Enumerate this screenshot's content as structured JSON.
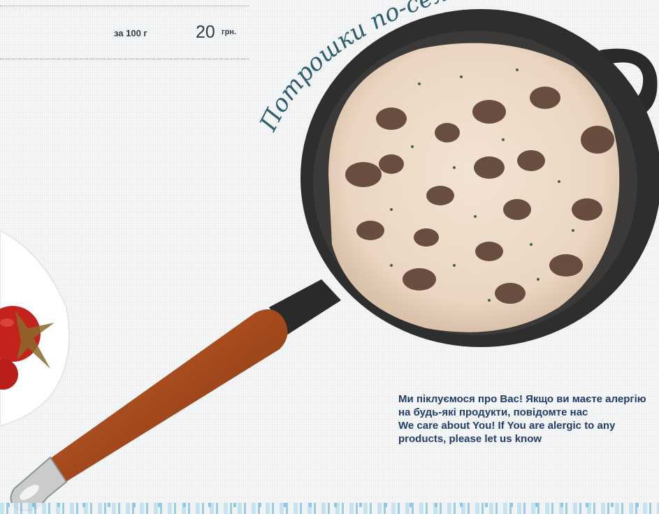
{
  "menu_item": {
    "title": "Потрошки по-селянськи",
    "per_weight": "за 100 г",
    "price": "20",
    "currency": "грн."
  },
  "notice": {
    "line1": "Ми піклуємося  про Вас! Якщо ви маєте алергію",
    "line2": "на будь-які продукти, повідомте нас",
    "line3": "We care about You! If You are alergic to any",
    "line4": "products, please let us know"
  },
  "colors": {
    "text_dark": "#2f3a46",
    "notice_blue": "#213d6b",
    "title_teal": "#2e5f6e"
  },
  "icons": {
    "pan": "skillet-image",
    "tomato": "tomato-image"
  }
}
